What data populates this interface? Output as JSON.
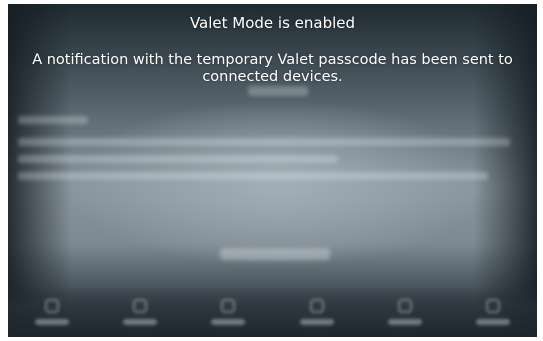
{
  "notification": {
    "title": "Valet Mode is enabled",
    "message": "A notification with the temporary Valet passcode has been sent to connected devices."
  },
  "bottom_nav": {
    "items": [
      {
        "icon": "app-icon"
      },
      {
        "icon": "microphone-icon"
      },
      {
        "icon": "phone-icon"
      },
      {
        "icon": "settings-icon"
      },
      {
        "icon": "media-icon"
      },
      {
        "icon": "search-icon"
      }
    ]
  },
  "colors": {
    "text": "#ffffff",
    "screen_top": "#1f2a31",
    "screen_mid": "#8a969f",
    "screen_bottom": "#2a333a"
  }
}
